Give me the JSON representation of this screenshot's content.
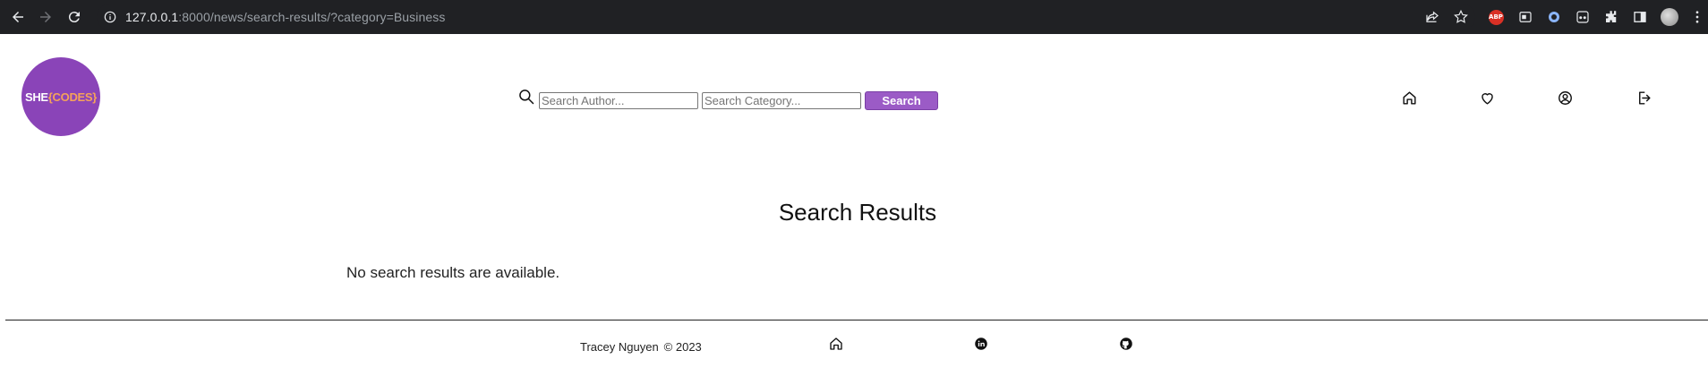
{
  "browser": {
    "url_host": "127.0.0.1",
    "url_path": ":8000/news/search-results/?category=Business",
    "extension_badge": "ABP"
  },
  "logo": {
    "text_she": "SHE",
    "text_codes": "{CODES}",
    "bg_color": "#8a44b8",
    "accent_color": "#f5a25a"
  },
  "search": {
    "author_placeholder": "Search Author...",
    "author_value": "",
    "category_placeholder": "Search Category...",
    "category_value": "",
    "button_label": "Search",
    "button_color": "#9b5bc6"
  },
  "nav_icons": [
    "home-icon",
    "heart-icon",
    "user-circle-icon",
    "logout-icon"
  ],
  "main": {
    "title": "Search Results",
    "empty_message": "No search results are available."
  },
  "footer": {
    "author": "Tracey Nguyen",
    "copyright": "© 2023",
    "icons": [
      "home-icon",
      "linkedin-icon",
      "github-icon"
    ]
  }
}
